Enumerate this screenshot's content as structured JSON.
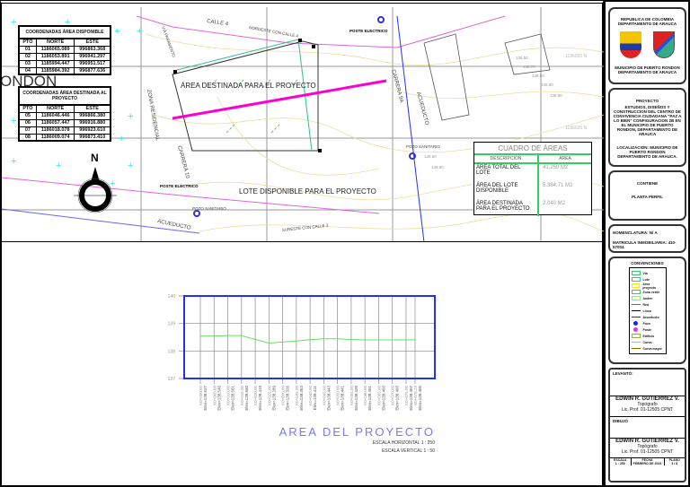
{
  "map": {
    "calle4": "CALLE 4",
    "nordeste": "NORDESTE CON CALLE 4",
    "poste1": "POSTE ELECTRICO",
    "poste2": "POSTE ELECTRICO",
    "area_proyecto": "ÁREA DESTINADA PARA EL PROYECTO",
    "lote": "LOTE  DISPONIBLE PARA EL PROYECTO",
    "carrera9a": "CARRERA 9A",
    "carrera10": "CARRERA 10",
    "acueducto1": "ACUEDUCTO",
    "acueducto2": "ACUEDUCTO",
    "pozo1": "POZO SANITARIO",
    "pozo2": "POZO SANITARIO",
    "zona": "ZONA RESIDENCIAL",
    "via": "VIA PARAMENTO",
    "sureste": "SURESTE CON CALLE 3",
    "rondon": "ONDON",
    "north": "N",
    "contours": [
      "138.50",
      "138.70",
      "138.60",
      "138.80",
      "138.90",
      "138.50",
      "138.80"
    ],
    "coord1": "1186050 N",
    "coord2": "1186025 N"
  },
  "table1": {
    "title": "COORDENADAS  ÁREA DISPONIBLE",
    "headers": [
      "PTO",
      "NORTE",
      "ESTE"
    ],
    "rows": [
      [
        "01",
        "1186065.089",
        "996863.368"
      ],
      [
        "02",
        "1186053.891",
        "996941.297"
      ],
      [
        "03",
        "1185994.447",
        "996951.517"
      ],
      [
        "04",
        "1185984.392",
        "996877.636"
      ]
    ]
  },
  "table2": {
    "title": "COORDENADAS  ÁREA DESTINADA AL PROYECTO",
    "headers": [
      "PTO",
      "NORTE",
      "ESTE"
    ],
    "rows": [
      [
        "05",
        "1186046.446",
        "996866.380"
      ],
      [
        "06",
        "1186057.447",
        "996916.880"
      ],
      [
        "07",
        "1186018.078",
        "996923.610"
      ],
      [
        "08",
        "1186009.074",
        "996873.410"
      ]
    ]
  },
  "areas": {
    "title": "CUADRO  DE  ÁREAS",
    "h1": "DESCRIPCIÓN",
    "h2": "ÁREA",
    "rows": [
      [
        "ÁREA TOTAL DEL LOTE",
        "41.250  M2"
      ],
      [
        "ÁREA DEL LOTE DISPONIBLE",
        "5.384,71  M2"
      ],
      [
        "ÁREA DESTINADA PARA EL PROYECTO",
        "2.040  M2"
      ]
    ]
  },
  "title_block": {
    "republica": "REPUBLICA DE COLOMBIA DEPARTAMENTO DE ARAUCA",
    "municipio": "MUNICIPIO DE PUERTO RONDON DEPARTAMENTO DE ARAUCA",
    "proyecto_h": "PROYECTO",
    "proyecto": "ESTUDIOS, DISEÑOS Y CONSTRUCCION DEL CENTRO DE CONVIVENCIA CIUDADANA \"PAZ A LO BIEN\" CONFIGURACION 2B EN EL MUNICIPIO DE PUERTO RONDON, DEPARTAMENTO DE ARAUCA",
    "localizacion": "LOCALIZACION: MUNICIPIO DE PUERTO RONDON DEPARTAMENTO DE ARAUCA.",
    "contiene_h": "CONTIENE",
    "contiene": "PLANTA PERFIL",
    "nomenclatura": "NOMENCLATURA:  N/ A",
    "matricula": "MATRICULA INMOBILIARIA:  410-57004",
    "convenciones": "CONVENCIONES",
    "conv_items": [
      "Via",
      "Lote",
      "Area proyecto",
      "Zona verde",
      "Anden",
      "Red",
      "Linea",
      "Acueducto",
      "Pozo",
      "Poste",
      "Edificio",
      "Curva",
      "Curva mayor"
    ],
    "levanto": "LEVANTÓ:",
    "dibujo": "DIBUJÓ",
    "name1": "EDWIN R. GUTIERREZ V.",
    "role1": "Topógrafo",
    "lic1": "Lic. Prof. 01-12505 CPNT",
    "name2": "EDWIN R. GUTIERREZ V.",
    "role2": "Topógrafo",
    "lic2": "Lic. Prof. 01-12505 CPNT",
    "escala_h": "ESCALA",
    "escala": "1 : 250",
    "fecha_h": "FECHA",
    "fecha": "FEBRERO DE 2023",
    "plano_h": "PLANO",
    "plano": "3 / 8"
  },
  "colors": {
    "profile_line": "#66dd66",
    "frame": "#2233ee",
    "project": "#ff00cc"
  },
  "chart_data": {
    "type": "line",
    "title": "AREA DEL PROYECTO",
    "subtitle1": "ESCALA HORIZONTAL 1 : 250",
    "subtitle2": "ESCALA VERTICAL 1 : 50",
    "ylim": [
      137,
      140
    ],
    "yticks": [
      "137",
      "138",
      "139",
      "140"
    ],
    "x": [
      0,
      5,
      10,
      15,
      20,
      25,
      30,
      35,
      40,
      45,
      50,
      55,
      60,
      65,
      70,
      75,
      78.29
    ],
    "y": [
      138.537,
      138.546,
      138.561,
      138.56,
      138.419,
      138.289,
      138.326,
      138.363,
      138.411,
      138.443,
      138.441,
      138.42,
      138.401,
      138.403,
      138.403,
      138.407,
      138.405
    ],
    "labels": [
      "K0+000.00",
      "K0+005.00",
      "K0+010.00",
      "K0+015.00",
      "K0+020.00",
      "K0+025.00",
      "K0+030.00",
      "K0+035.00",
      "K0+040.00",
      "K0+045.00",
      "K0+050.00",
      "K0+055.00",
      "K0+060.00",
      "K0+065.00",
      "K0+070.00",
      "K0+075.00",
      "K0+078.29"
    ],
    "elev_labels": [
      "Elev=138.537",
      "Elev=138.546",
      "Elev=138.561",
      "Elev=138.560",
      "Elev=138.419",
      "Elev=138.289",
      "Elev=138.326",
      "Elev=138.363",
      "Elev=138.411",
      "Elev=138.443",
      "Elev=138.441",
      "Elev=138.420",
      "Elev=138.401",
      "Elev=138.403",
      "Elev=138.403",
      "Elev=138.407",
      "Elev=138.405"
    ]
  }
}
